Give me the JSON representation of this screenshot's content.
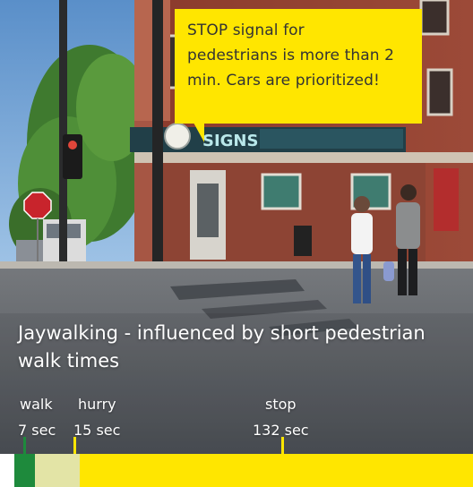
{
  "callout": {
    "lines": [
      "STOP signal for",
      "pedestrians is more than 2",
      "min. Cars are prioritized!"
    ]
  },
  "caption": {
    "lines": [
      "Jaywalking - influenced by short pedestrian",
      "walk times"
    ]
  },
  "photo_signage": {
    "store_sign": "SIGNS"
  },
  "phases": {
    "walk": {
      "label": "walk",
      "duration": "7 sec",
      "seconds": 7,
      "color": "#1e8a3c"
    },
    "hurry": {
      "label": "hurry",
      "duration": "15 sec",
      "seconds": 15,
      "color": "#e3e4a6"
    },
    "stop": {
      "label": "stop",
      "duration": "132 sec",
      "seconds": 132,
      "color": "#ffe600"
    }
  },
  "colors": {
    "callout_bg": "#ffe600",
    "tick_walk": "#1e8a3c",
    "tick_yellow": "#ffe600"
  }
}
